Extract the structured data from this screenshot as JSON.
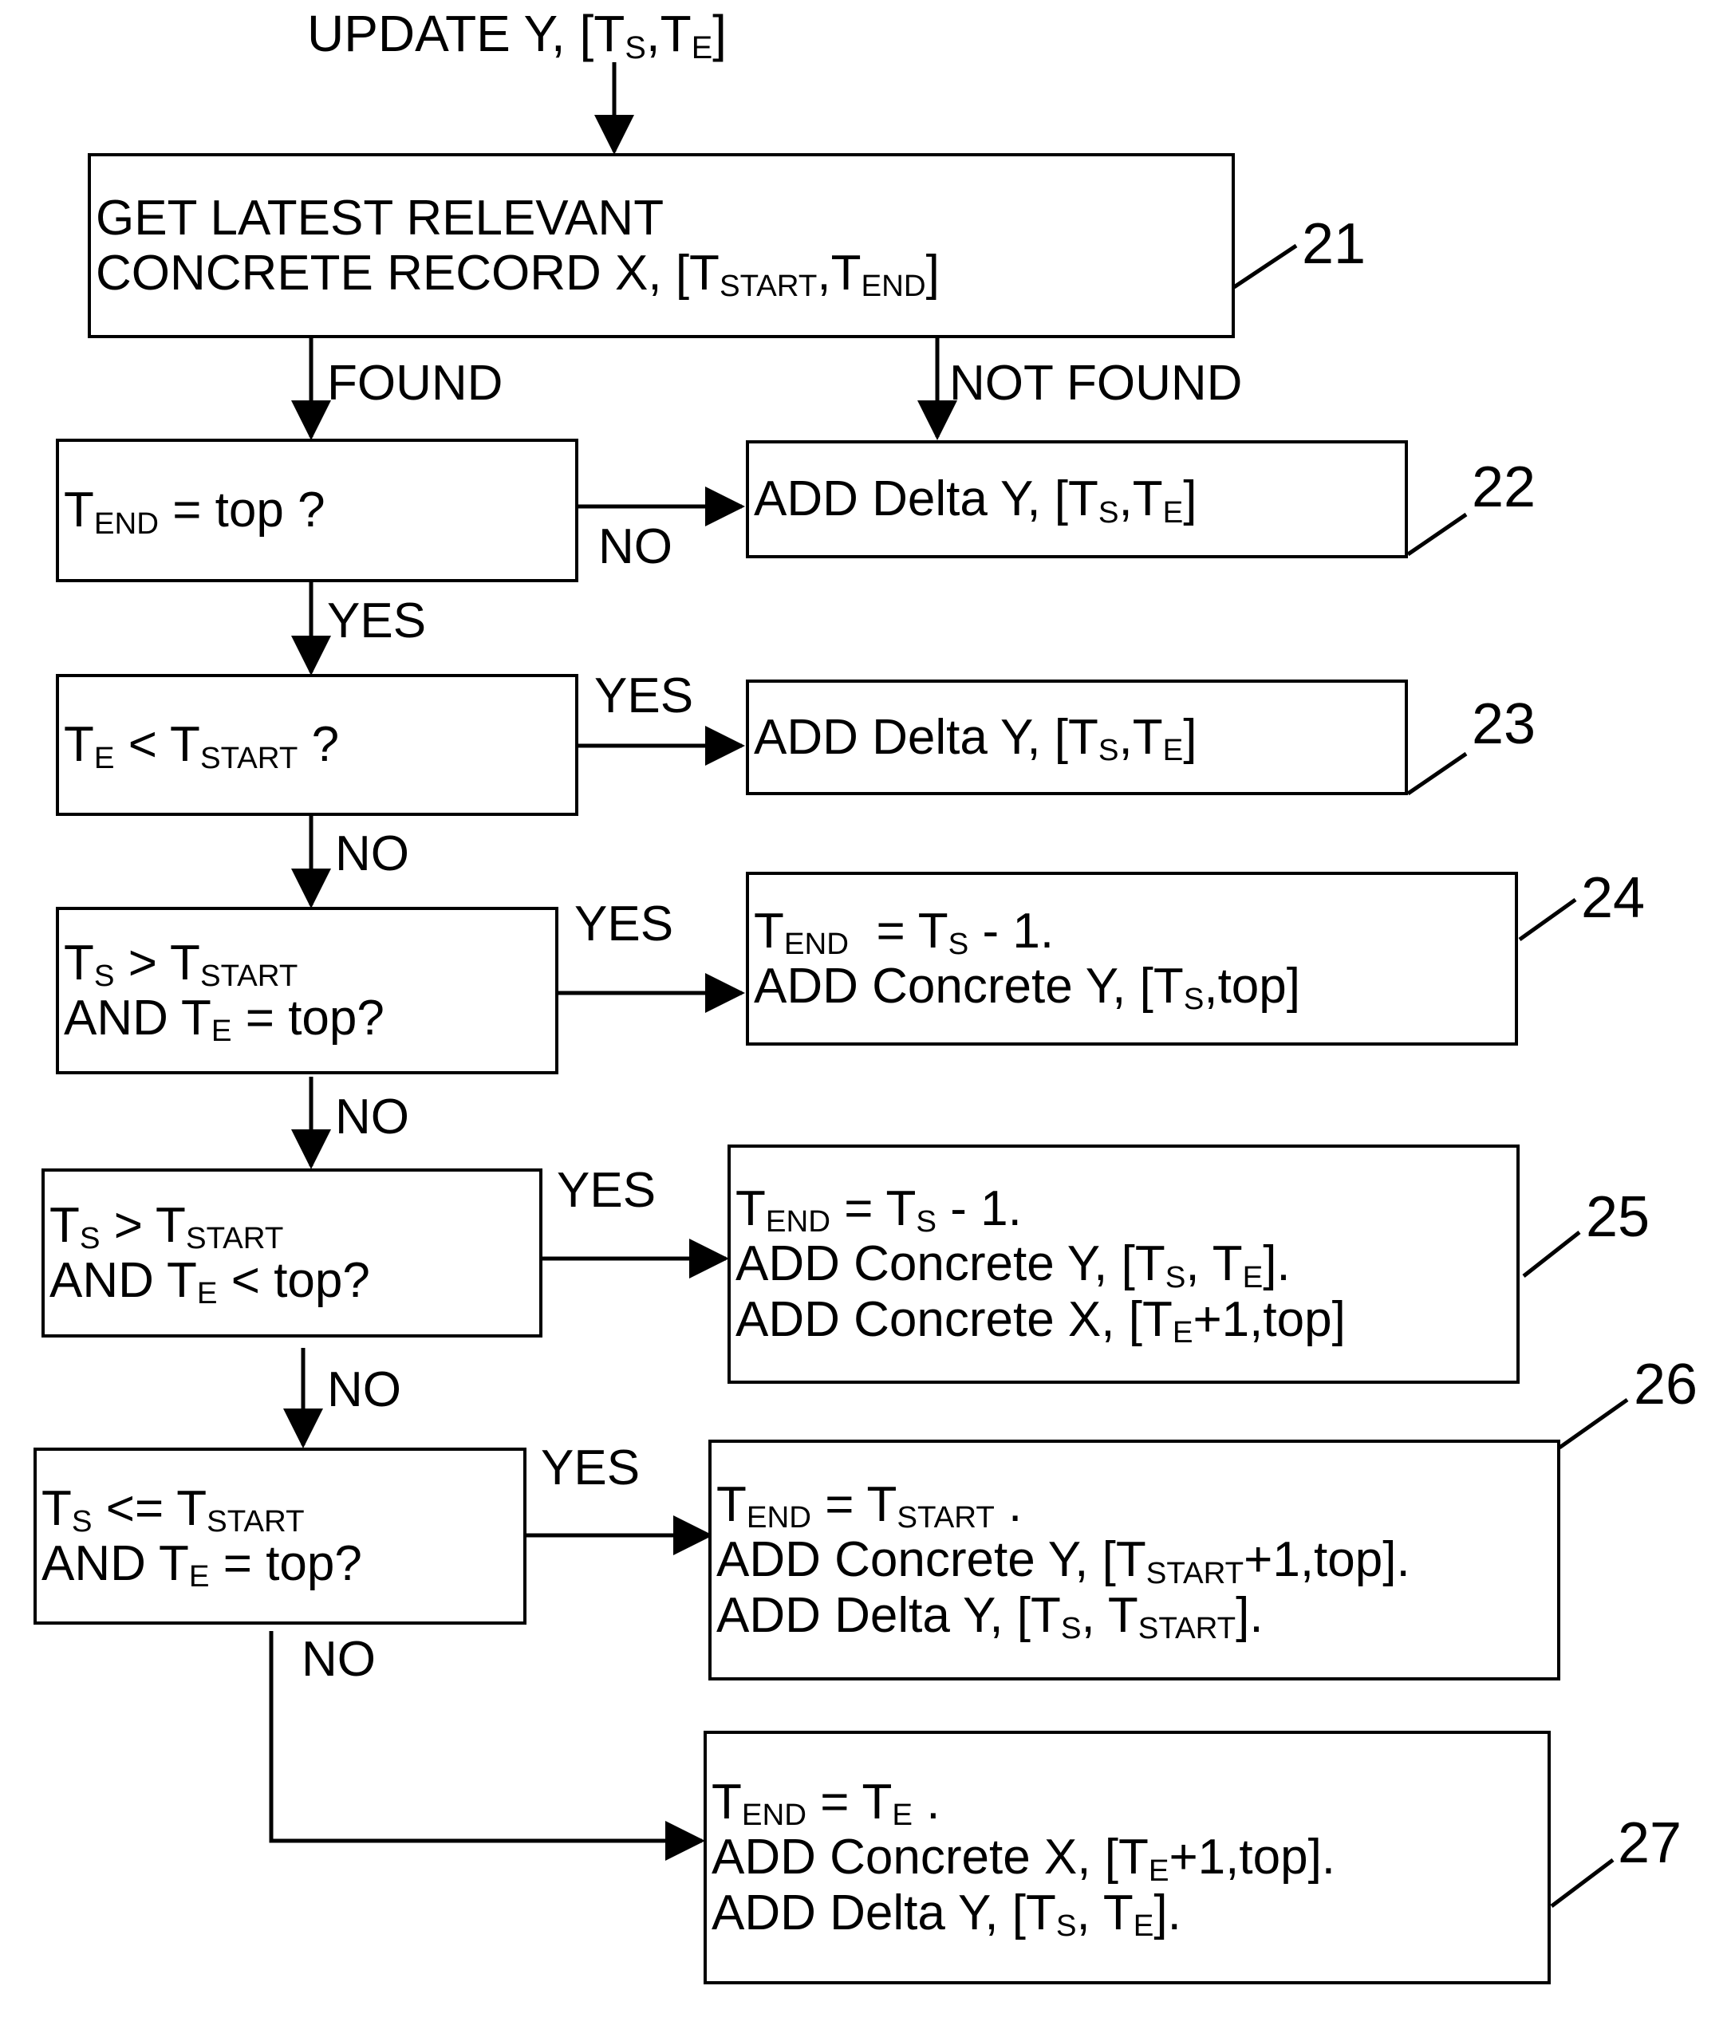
{
  "figure": {
    "title": "UPDATE Y, [TS,TE]",
    "title_parts": [
      "UPDATE Y, [T",
      "S",
      ",T",
      "E",
      "]"
    ]
  },
  "nodes": [
    {
      "id": "n21",
      "ref": "21",
      "lines": [
        "GET LATEST RELEVANT",
        "CONCRETE RECORD X, [TSTART,TEND]"
      ]
    },
    {
      "id": "n_tend_top",
      "ref": "",
      "lines": [
        "TEND = top ?"
      ]
    },
    {
      "id": "n22",
      "ref": "22",
      "lines": [
        "ADD Delta Y, [TS,TE]"
      ]
    },
    {
      "id": "n_te_lt_tstart",
      "ref": "",
      "lines": [
        "TE < TSTART ?"
      ]
    },
    {
      "id": "n23",
      "ref": "23",
      "lines": [
        "ADD Delta Y, [TS,TE]"
      ]
    },
    {
      "id": "n_ts_gt_and_te_eq",
      "ref": "",
      "lines": [
        "TS > TSTART",
        "AND TE = top?"
      ]
    },
    {
      "id": "n24",
      "ref": "24",
      "lines": [
        "TEND  = TS - 1.",
        "ADD Concrete Y, [TS,top]"
      ]
    },
    {
      "id": "n_ts_gt_and_te_lt",
      "ref": "",
      "lines": [
        "TS > TSTART",
        "AND TE < top?"
      ]
    },
    {
      "id": "n25",
      "ref": "25",
      "lines": [
        "TEND = TS - 1.",
        "ADD Concrete Y, [TS, TE].",
        "ADD Concrete X, [TE+1,top]"
      ]
    },
    {
      "id": "n_ts_le_and_te_eq",
      "ref": "",
      "lines": [
        "TS <= TSTART",
        "AND TE = top?"
      ]
    },
    {
      "id": "n26",
      "ref": "26",
      "lines": [
        "TEND = TSTART .",
        "ADD Concrete Y, [TSTART+1,top].",
        "ADD Delta Y, [TS, TSTART]."
      ]
    },
    {
      "id": "n27",
      "ref": "27",
      "lines": [
        "TEND = TE .",
        "ADD Concrete X, [TE+1,top].",
        "ADD Delta Y, [TS, TE]."
      ]
    }
  ],
  "edge_labels": {
    "found": "FOUND",
    "not_found": "NOT FOUND",
    "no_1": "NO",
    "yes_1": "YES",
    "yes_2": "YES",
    "no_2": "NO",
    "yes_3": "YES",
    "no_3": "NO",
    "yes_4": "YES",
    "no_4": "NO",
    "yes_5": "YES",
    "no_5": "NO"
  },
  "ref_numbers": {
    "r21": "21",
    "r22": "22",
    "r23": "23",
    "r24": "24",
    "r25": "25",
    "r26": "26",
    "r27": "27"
  },
  "style": {
    "stroke": "#000000",
    "background": "#ffffff"
  }
}
